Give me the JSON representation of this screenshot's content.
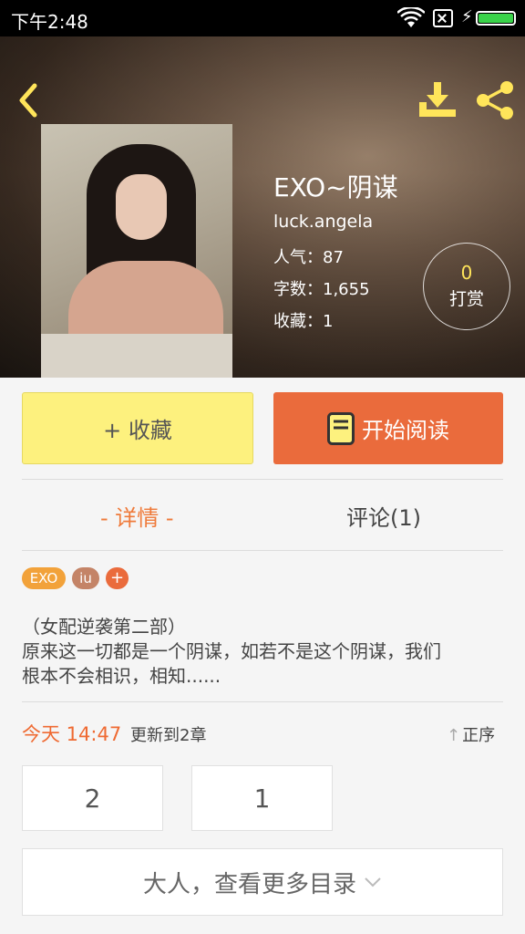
{
  "status_bar": {
    "time": "下午2:48",
    "battery_color": "#3ad34a"
  },
  "header": {
    "back_icon": "chevron-left-icon",
    "download_icon": "download-icon",
    "share_icon": "share-icon",
    "icon_color": "#ffe55a"
  },
  "book": {
    "title": "EXO~阴谋",
    "author": "luck.angela",
    "popularity": "人气：87",
    "word_count": "字数：1,655",
    "favorites": "收藏：1"
  },
  "tip": {
    "count": "0",
    "label": "打赏"
  },
  "actions": {
    "collect_label": "+ 收藏",
    "read_label": "开始阅读",
    "collect_color": "#fdf17e",
    "read_color": "#ea6b3c"
  },
  "tabs": {
    "details": "- 详情 -",
    "comments": "评论(1)",
    "active_color": "#ef7a3a"
  },
  "tags": {
    "exo": "EXO",
    "iu": "iu",
    "add": "+"
  },
  "synopsis": {
    "line1": "（女配逆袭第二部）",
    "line2": "原来这一切都是一个阴谋，如若不是这个阴谋，我们",
    "line3": "根本不会相识，相知......"
  },
  "update": {
    "time": "今天 14:47",
    "text": "更新到2章",
    "sort_label": "正序",
    "sort_icon": "arrow-up-icon"
  },
  "chapters": {
    "first": "2",
    "second": "1"
  },
  "more": {
    "label": "大人，查看更多目录",
    "icon": "chevron-down-icon"
  }
}
